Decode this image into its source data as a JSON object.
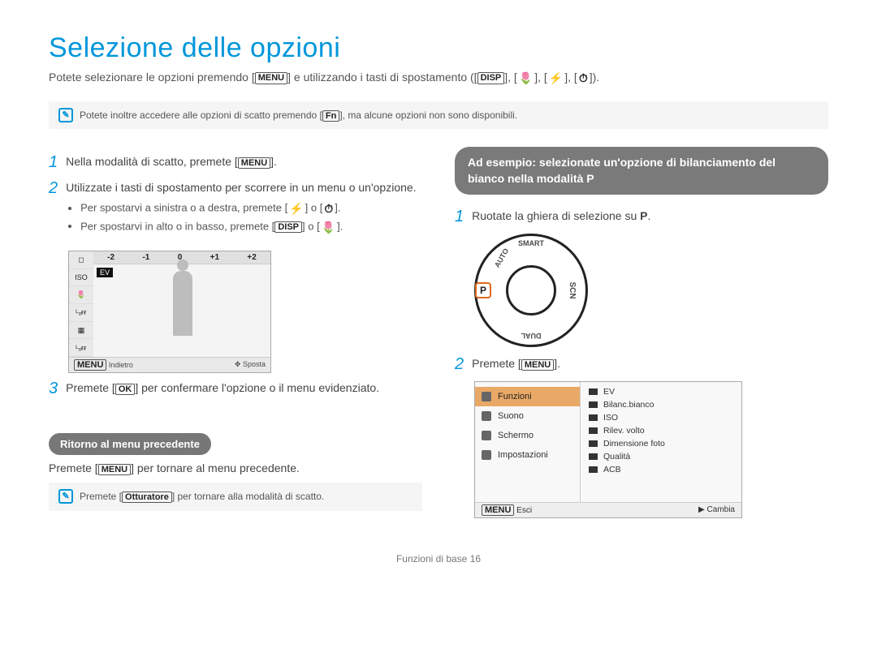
{
  "title": "Selezione delle opzioni",
  "subtitle": {
    "pre": "Potete selezionare le opzioni premendo [",
    "menu": "MENU",
    "mid": "] e utilizzando i tasti di spostamento ([",
    "disp": "DISP",
    "sep": "], [",
    "macro": "🌷",
    "flash": "⚡",
    "timer": "⏱",
    "end": "])."
  },
  "note1": {
    "pre": "Potete inoltre accedere alle opzioni di scatto premendo [",
    "fn": "Fn",
    "post": "], ma alcune opzioni non sono disponibili."
  },
  "left": {
    "step1": {
      "num": "1",
      "pre": "Nella modalità di scatto, premete [",
      "menu": "MENU",
      "post": "]."
    },
    "step2": {
      "num": "2",
      "text": "Utilizzate i tasti di spostamento per scorrere in un menu o un'opzione.",
      "bullets": [
        {
          "pre": "Per spostarvi a sinistra o a destra, premete [",
          "k1": "⚡",
          "mid": "] o [",
          "k2": "⏱",
          "post": "]."
        },
        {
          "pre": "Per spostarvi in alto o in basso, premete [",
          "k1": "DISP",
          "mid": "] o [",
          "k2": "🌷",
          "post": "]."
        }
      ]
    },
    "ev": {
      "scale": [
        "-2",
        "-1",
        "0",
        "+1",
        "+2"
      ],
      "label": "EV",
      "sidebar": [
        "◻",
        "ISO",
        "🌷",
        "ᴸₒғғ",
        "▦",
        "ᴸₒғғ"
      ],
      "back_key": "MENU",
      "back": "Indietro",
      "move_icon": "✥",
      "move": "Sposta"
    },
    "step3": {
      "num": "3",
      "pre": "Premete [",
      "ok": "OK",
      "post": "] per confermare l'opzione o il menu evidenziato."
    },
    "return_pill": "Ritorno al menu precedente",
    "return_text": {
      "pre": "Premete [",
      "menu": "MENU",
      "post": "] per tornare al menu precedente."
    },
    "note2": {
      "pre": "Premete [",
      "k": "Otturatore",
      "post": "] per tornare alla modalità di scatto."
    }
  },
  "right": {
    "example": "Ad esempio: selezionate un'opzione di bilanciamento del bianco nella modalità P",
    "step1": {
      "num": "1",
      "pre": "Ruotate la ghiera di selezione su ",
      "mode": "P",
      "post": "."
    },
    "dial": {
      "selected": "P",
      "top": "SMART",
      "right": "SCN",
      "bottom": "DUAL",
      "left": "AUTO"
    },
    "step2": {
      "num": "2",
      "pre": "Premete [",
      "menu": "MENU",
      "post": "]."
    },
    "menu": {
      "left": [
        "Funzioni",
        "Suono",
        "Schermo",
        "Impostazioni"
      ],
      "selected_index": 0,
      "right": [
        "EV",
        "Bilanc.bianco",
        "ISO",
        "Rilev. volto",
        "Dimensione foto",
        "Qualità",
        "ACB"
      ],
      "back_key": "MENU",
      "back": "Esci",
      "change_icon": "▶",
      "change": "Cambia"
    }
  },
  "footer": {
    "section": "Funzioni di base",
    "page": "16"
  }
}
